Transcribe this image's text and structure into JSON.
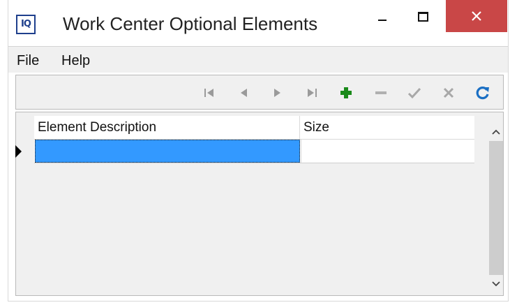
{
  "window": {
    "title": "Work Center Optional Elements",
    "app_icon_text": "IQ",
    "controls": [
      "minimize-icon",
      "maximize-icon",
      "close-icon"
    ],
    "close_color": "#c94747"
  },
  "menubar": {
    "items": [
      {
        "label": "File"
      },
      {
        "label": "Help"
      }
    ]
  },
  "toolbar": {
    "buttons": [
      {
        "icon": "first-record-icon",
        "enabled": false
      },
      {
        "icon": "prior-record-icon",
        "enabled": false
      },
      {
        "icon": "next-record-icon",
        "enabled": false
      },
      {
        "icon": "last-record-icon",
        "enabled": false
      },
      {
        "icon": "add-record-icon",
        "enabled": true,
        "color": "#1a8a1a"
      },
      {
        "icon": "delete-record-icon",
        "enabled": false
      },
      {
        "icon": "post-edit-icon",
        "enabled": false
      },
      {
        "icon": "cancel-edit-icon",
        "enabled": false
      },
      {
        "icon": "refresh-icon",
        "enabled": true,
        "color": "#1a6fc4"
      }
    ]
  },
  "grid": {
    "columns": [
      "Element Description",
      "Size"
    ],
    "rows": [
      {
        "element_description": "",
        "size": "",
        "selected": true
      }
    ],
    "selection_color": "#3399ff"
  }
}
